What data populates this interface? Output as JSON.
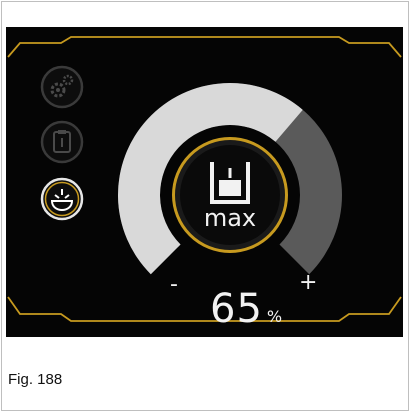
{
  "side_buttons": [
    {
      "name": "settings",
      "icon": "gears-icon",
      "active": false
    },
    {
      "name": "tank",
      "icon": "clipboard-tank-icon",
      "active": false
    },
    {
      "name": "pump",
      "icon": "pump-level-icon",
      "active": true
    }
  ],
  "gauge": {
    "level_percent": 65,
    "value_text": "65",
    "unit": "%",
    "minus_label": "-",
    "plus_label": "+",
    "center_label": "max",
    "center_icon": "container-max-icon"
  },
  "colors": {
    "accent": "#c79a1f",
    "gauge_filled": "#d9d9d9",
    "gauge_empty": "#5a5a5a",
    "screen_bg": "#050505"
  },
  "caption": "Fig. 188"
}
